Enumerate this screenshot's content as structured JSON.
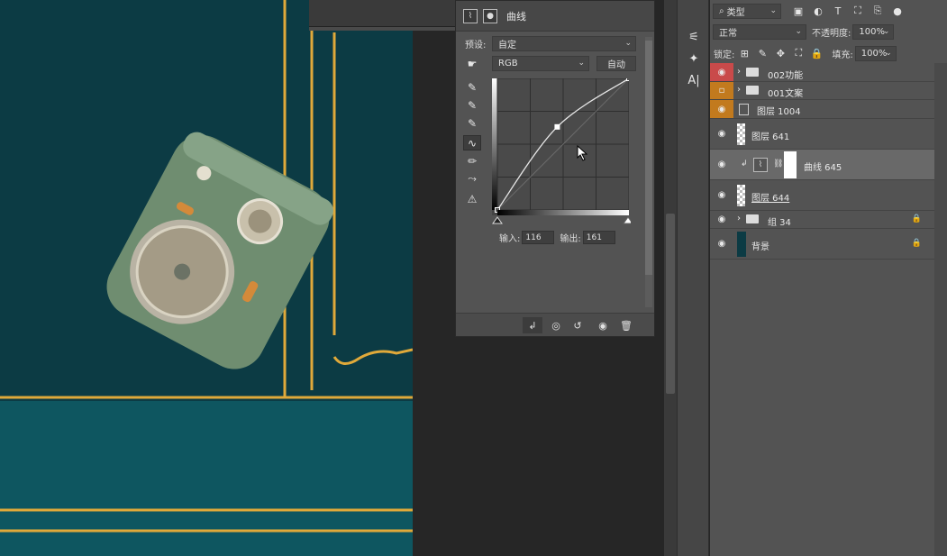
{
  "properties_panel": {
    "title": "曲线",
    "preset_label": "预设:",
    "preset_value": "自定",
    "channel_value": "RGB",
    "auto_button": "自动",
    "input_label": "输入:",
    "input_value": "116",
    "output_label": "输出:",
    "output_value": "161"
  },
  "layers_panel": {
    "filter_kind": "类型",
    "blend_mode": "正常",
    "opacity_label": "不透明度:",
    "opacity_value": "100%",
    "lock_label": "锁定:",
    "fill_label": "填充:",
    "fill_value": "100%",
    "layers": [
      {
        "name": "002功能",
        "type": "group",
        "tag_color": "#c94a4a"
      },
      {
        "name": "001文案",
        "type": "group",
        "tag_color": "#c27a1e"
      },
      {
        "name": "图层 1004",
        "type": "smart",
        "tag_color": "#c27a1e"
      },
      {
        "name": "图层 641",
        "type": "pixel"
      },
      {
        "name": "曲线 645",
        "type": "adjustment",
        "selected": true
      },
      {
        "name": "图层 644",
        "type": "pixel"
      },
      {
        "name": "组 34",
        "type": "group",
        "locked": true
      },
      {
        "name": "背景",
        "type": "background",
        "locked": true
      }
    ]
  },
  "canvas": {
    "background_color": "#0c3b44",
    "accent_color": "#e0a93a",
    "lower_band_color": "#0e5660"
  },
  "curve": {
    "points": [
      [
        0,
        0
      ],
      [
        116,
        161
      ],
      [
        255,
        255
      ]
    ]
  }
}
